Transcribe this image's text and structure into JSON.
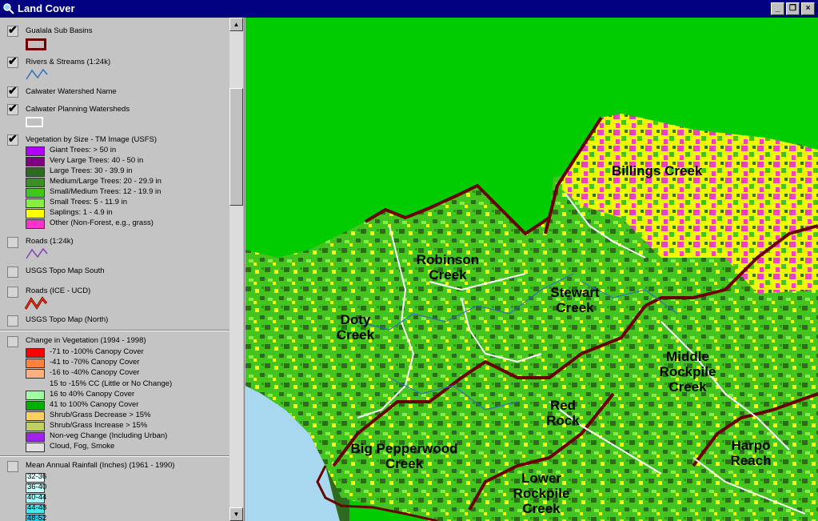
{
  "window": {
    "title": "Land Cover",
    "buttons": [
      "_",
      "❐",
      "×"
    ]
  },
  "legend": {
    "layers": [
      {
        "name": "Gualala Sub Basins",
        "checked": true
      },
      {
        "name": "Rivers & Streams (1:24k)",
        "checked": true
      },
      {
        "name": "Calwater Watershed Name",
        "checked": true
      },
      {
        "name": "Calwater Planning Watersheds",
        "checked": true
      },
      {
        "name": "Vegetation by Size - TM Image (USFS)",
        "checked": true
      },
      {
        "name": "Roads (1:24k)",
        "checked": false
      },
      {
        "name": "USGS Topo Map South",
        "checked": false
      },
      {
        "name": "Roads (ICE - UCD)",
        "checked": false
      },
      {
        "name": "USGS Topo Map (North)",
        "checked": false
      },
      {
        "name": "Change in Vegetation (1994 - 1998)",
        "checked": false
      },
      {
        "name": "Mean Annual Rainfall (Inches) (1961 - 1990)",
        "checked": false
      }
    ],
    "vegetation_classes": [
      {
        "label": "Giant Trees: > 50 in",
        "color": "#b000ff"
      },
      {
        "label": "Very Large Trees: 40 - 50 in",
        "color": "#800080"
      },
      {
        "label": "Large Trees: 30 - 39.9 in",
        "color": "#2e6b1e"
      },
      {
        "label": "Medium/Large Trees: 20 - 29.9 in",
        "color": "#3c8c28"
      },
      {
        "label": "Small/Medium Trees: 12 - 19.9 in",
        "color": "#44c41e"
      },
      {
        "label": "Small Trees: 5 - 11.9 in",
        "color": "#88ee44"
      },
      {
        "label": "Saplings: 1 - 4.9 in",
        "color": "#ffff00"
      },
      {
        "label": "Other (Non-Forest, e.g., grass)",
        "color": "#ff33cc"
      }
    ],
    "change_classes": [
      {
        "label": "-71 to -100% Canopy Cover",
        "color": "#ff0000"
      },
      {
        "label": "-41 to -70% Canopy Cover",
        "color": "#ff8040"
      },
      {
        "label": "-16 to -40% Canopy Cover",
        "color": "#ffb080"
      },
      {
        "label": "15 to -15% CC (Little or No Change)",
        "color": ""
      },
      {
        "label": "16 to 40% Canopy Cover",
        "color": "#a0ffa0"
      },
      {
        "label": "41 to 100% Canopy Cover",
        "color": "#00b000"
      },
      {
        "label": "Shrub/Grass Decrease > 15%",
        "color": "#ffd060"
      },
      {
        "label": "Shrub/Grass Increase > 15%",
        "color": "#c0d060"
      },
      {
        "label": "Non-veg Change (Including Urban)",
        "color": "#a020f0"
      },
      {
        "label": "Cloud, Fog, Smoke",
        "color": "#e0e0e0"
      }
    ],
    "rainfall_classes": [
      {
        "label": "32-36",
        "color": "#e8ffff"
      },
      {
        "label": "36-40",
        "color": "#c8ffff"
      },
      {
        "label": "40-44",
        "color": "#a0f8f8"
      },
      {
        "label": "44-48",
        "color": "#40e8f0"
      },
      {
        "label": "48-52",
        "color": "#20c8e0"
      }
    ]
  },
  "map": {
    "watersheds": [
      "Billings Creek",
      "Robinson Creek",
      "Stewart Creek",
      "Doty Creek",
      "Middle Rockpile Creek",
      "Red Rock",
      "Big Pepperwood Creek",
      "Harpo Reach",
      "Lower Rockpile Creek"
    ],
    "colors": {
      "outside": "#00cc00",
      "ocean": "#a8d8f0",
      "coast": "#2e6b1e",
      "boundary": "#6b0000"
    }
  }
}
